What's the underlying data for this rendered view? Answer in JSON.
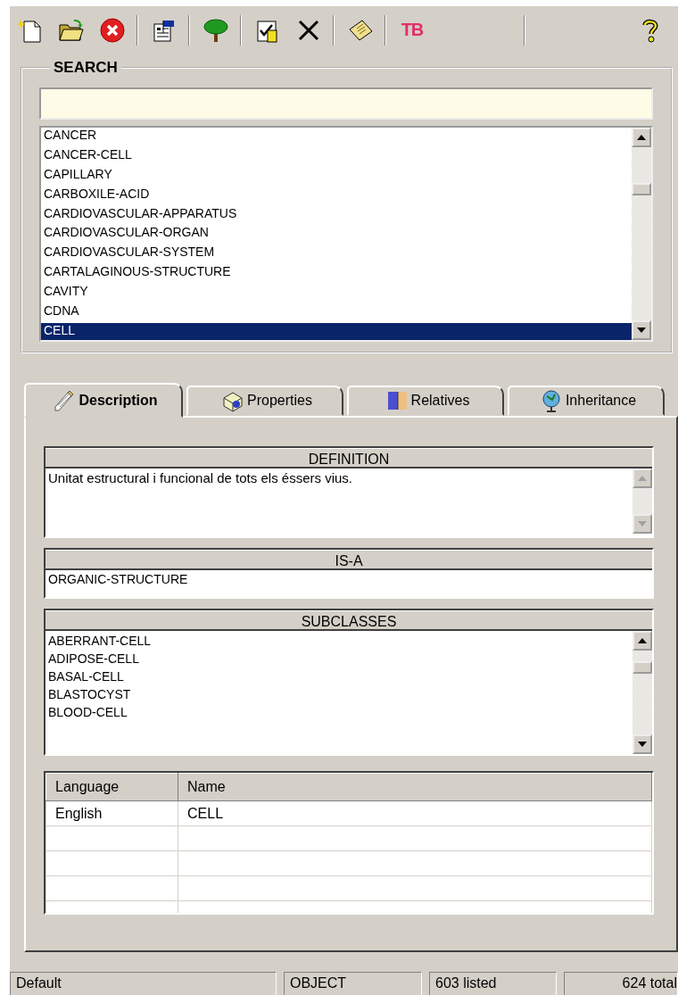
{
  "toolbar": {
    "groups": [
      [
        {
          "kind": "new"
        },
        {
          "kind": "open"
        },
        {
          "kind": "delete"
        }
      ],
      [
        {
          "kind": "properties"
        }
      ],
      [
        {
          "kind": "tree"
        }
      ],
      [
        {
          "kind": "checklist"
        },
        {
          "kind": "cross"
        }
      ],
      [
        {
          "kind": "note"
        }
      ],
      [
        {
          "kind": "text",
          "label": "TB"
        }
      ]
    ],
    "help": {
      "kind": "help"
    }
  },
  "search": {
    "title": "SEARCH",
    "items": [
      {
        "label": "CANCER",
        "selected": false
      },
      {
        "label": "CANCER-CELL",
        "selected": false
      },
      {
        "label": "CAPILLARY",
        "selected": false
      },
      {
        "label": "CARBOXILE-ACID",
        "selected": false
      },
      {
        "label": "CARDIOVASCULAR-APPARATUS",
        "selected": false
      },
      {
        "label": "CARDIOVASCULAR-ORGAN",
        "selected": false
      },
      {
        "label": "CARDIOVASCULAR-SYSTEM",
        "selected": false
      },
      {
        "label": "CARTALAGINOUS-STRUCTURE",
        "selected": false
      },
      {
        "label": "CAVITY",
        "selected": false
      },
      {
        "label": "CDNA",
        "selected": false
      },
      {
        "label": "CELL",
        "selected": true
      }
    ]
  },
  "tabs": [
    {
      "label": "Description",
      "kind": "pencil",
      "selected": true
    },
    {
      "label": "Properties",
      "kind": "box",
      "selected": false
    },
    {
      "label": "Relatives",
      "kind": "card",
      "selected": false
    },
    {
      "label": "Inheritance",
      "kind": "globe",
      "selected": false
    }
  ],
  "description": {
    "definition": {
      "title": "DEFINITION",
      "text": "Unitat estructural i funcional de tots els éssers vius."
    },
    "is_a": {
      "title": "IS-A",
      "value": "ORGANIC-STRUCTURE"
    },
    "subclasses": {
      "title": "SUBCLASSES",
      "items": [
        "ABERRANT-CELL",
        "ADIPOSE-CELL",
        "BASAL-CELL",
        "BLASTOCYST",
        "BLOOD-CELL"
      ]
    },
    "names_table": {
      "columns": [
        "Language",
        "Name"
      ],
      "rows": [
        [
          "English",
          "CELL"
        ]
      ]
    }
  },
  "status_bar": [
    "Default",
    "OBJECT",
    "603 listed",
    "624 total"
  ]
}
